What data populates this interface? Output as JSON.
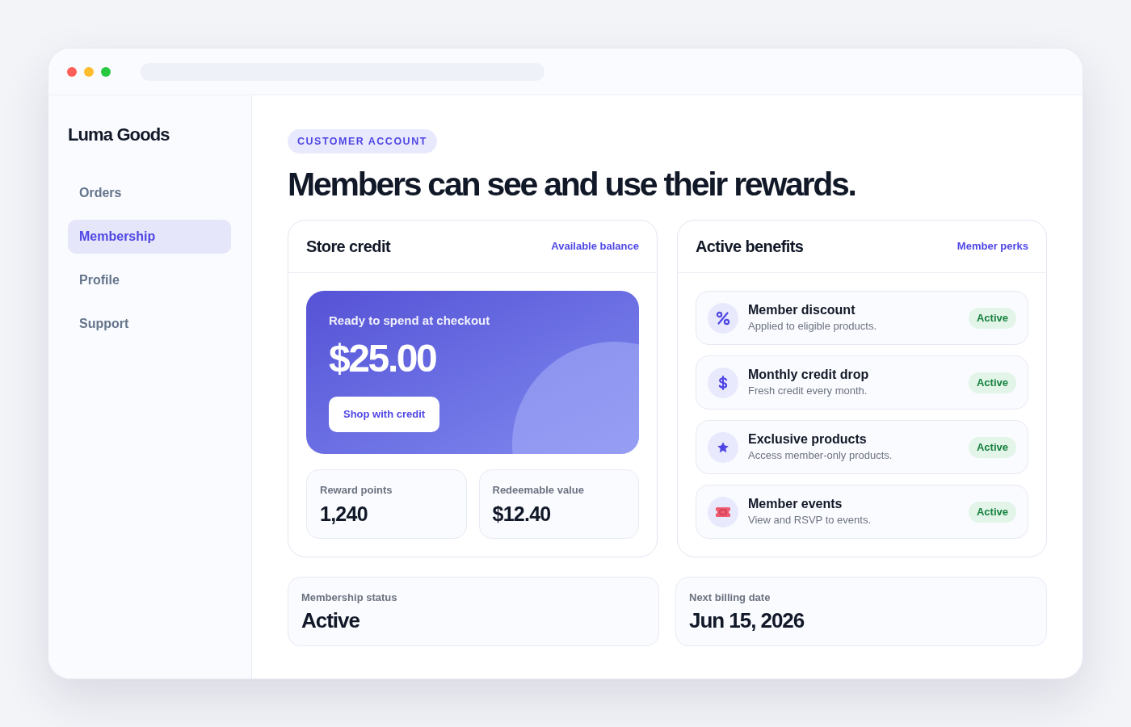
{
  "sidebar": {
    "brand": "Luma Goods",
    "items": [
      {
        "label": "Orders",
        "selected": false
      },
      {
        "label": "Membership",
        "selected": true
      },
      {
        "label": "Profile",
        "selected": false
      },
      {
        "label": "Support",
        "selected": false
      }
    ]
  },
  "header": {
    "eyebrow": "CUSTOMER ACCOUNT",
    "title": "Members can see and use their rewards."
  },
  "store_credit": {
    "title": "Store credit",
    "link": "Available balance",
    "hero": {
      "caption": "Ready to spend at checkout",
      "amount": "$25.00",
      "button": "Shop with credit"
    },
    "stats": [
      {
        "label": "Reward points",
        "value": "1,240"
      },
      {
        "label": "Redeemable value",
        "value": "$12.40"
      }
    ]
  },
  "benefits": {
    "title": "Active benefits",
    "link": "Member perks",
    "items": [
      {
        "kind": "percent",
        "title": "Member discount",
        "description": "Applied to eligible products.",
        "status": "Active"
      },
      {
        "kind": "dollar",
        "title": "Monthly credit drop",
        "description": "Fresh credit every month.",
        "status": "Active"
      },
      {
        "kind": "star",
        "title": "Exclusive products",
        "description": "Access member-only products.",
        "status": "Active"
      },
      {
        "kind": "ticket",
        "title": "Member events",
        "description": "View and RSVP to events.",
        "status": "Active"
      }
    ]
  },
  "summary": [
    {
      "label": "Membership status",
      "value": "Active"
    },
    {
      "label": "Next billing date",
      "value": "Jun 15, 2026"
    }
  ]
}
